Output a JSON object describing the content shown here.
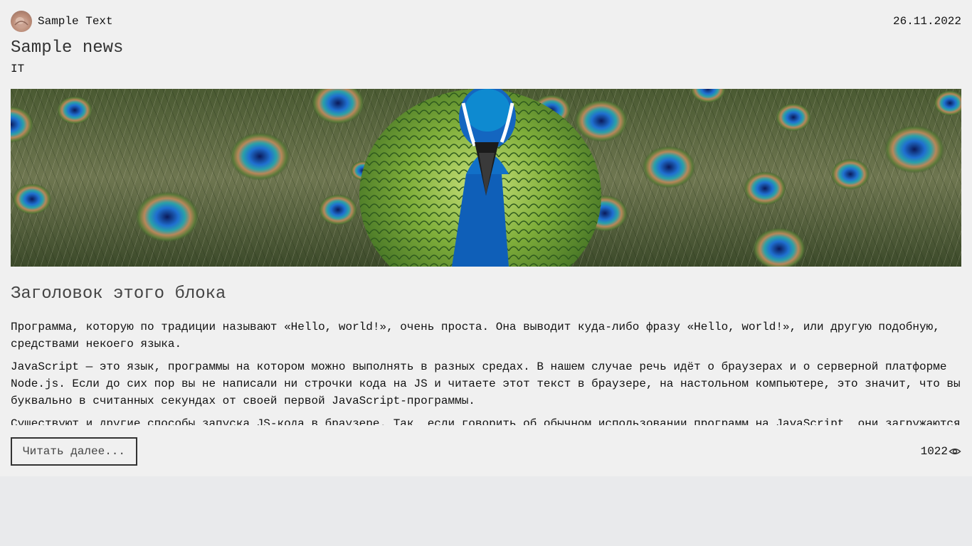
{
  "post": {
    "author": "Sample Text",
    "date": "26.11.2022",
    "title": "Sample news",
    "category": "IT",
    "block_title": "Заголовок этого блока",
    "paragraphs": [
      "Программа, которую по традиции называют «Hello, world!», очень проста. Она выводит куда-либо фразу «Hello, world!», или другую подобную, средствами некоего языка.",
      "JavaScript — это язык, программы на котором можно выполнять в разных средах. В нашем случае речь идёт о браузерах и о серверной платформе Node.js. Если до сих пор вы не написали ни строчки кода на JS и читаете этот текст в браузере, на настольном компьютере, это значит, что вы буквально в считанных секундах от своей первой JavaScript-программы.",
      "Существуют и другие способы запуска JS-кода в браузере. Так, если говорить об обычном использовании программ на JavaScript, они загружаются"
    ],
    "read_more_label": "Читать далее...",
    "views": "1022"
  },
  "icons": {
    "avatar": "avatar-image",
    "views": "eye-icon"
  },
  "colors": {
    "background": "#f0f0f0",
    "page": "#e9eaec",
    "text": "#111111",
    "button_border": "#333333"
  }
}
